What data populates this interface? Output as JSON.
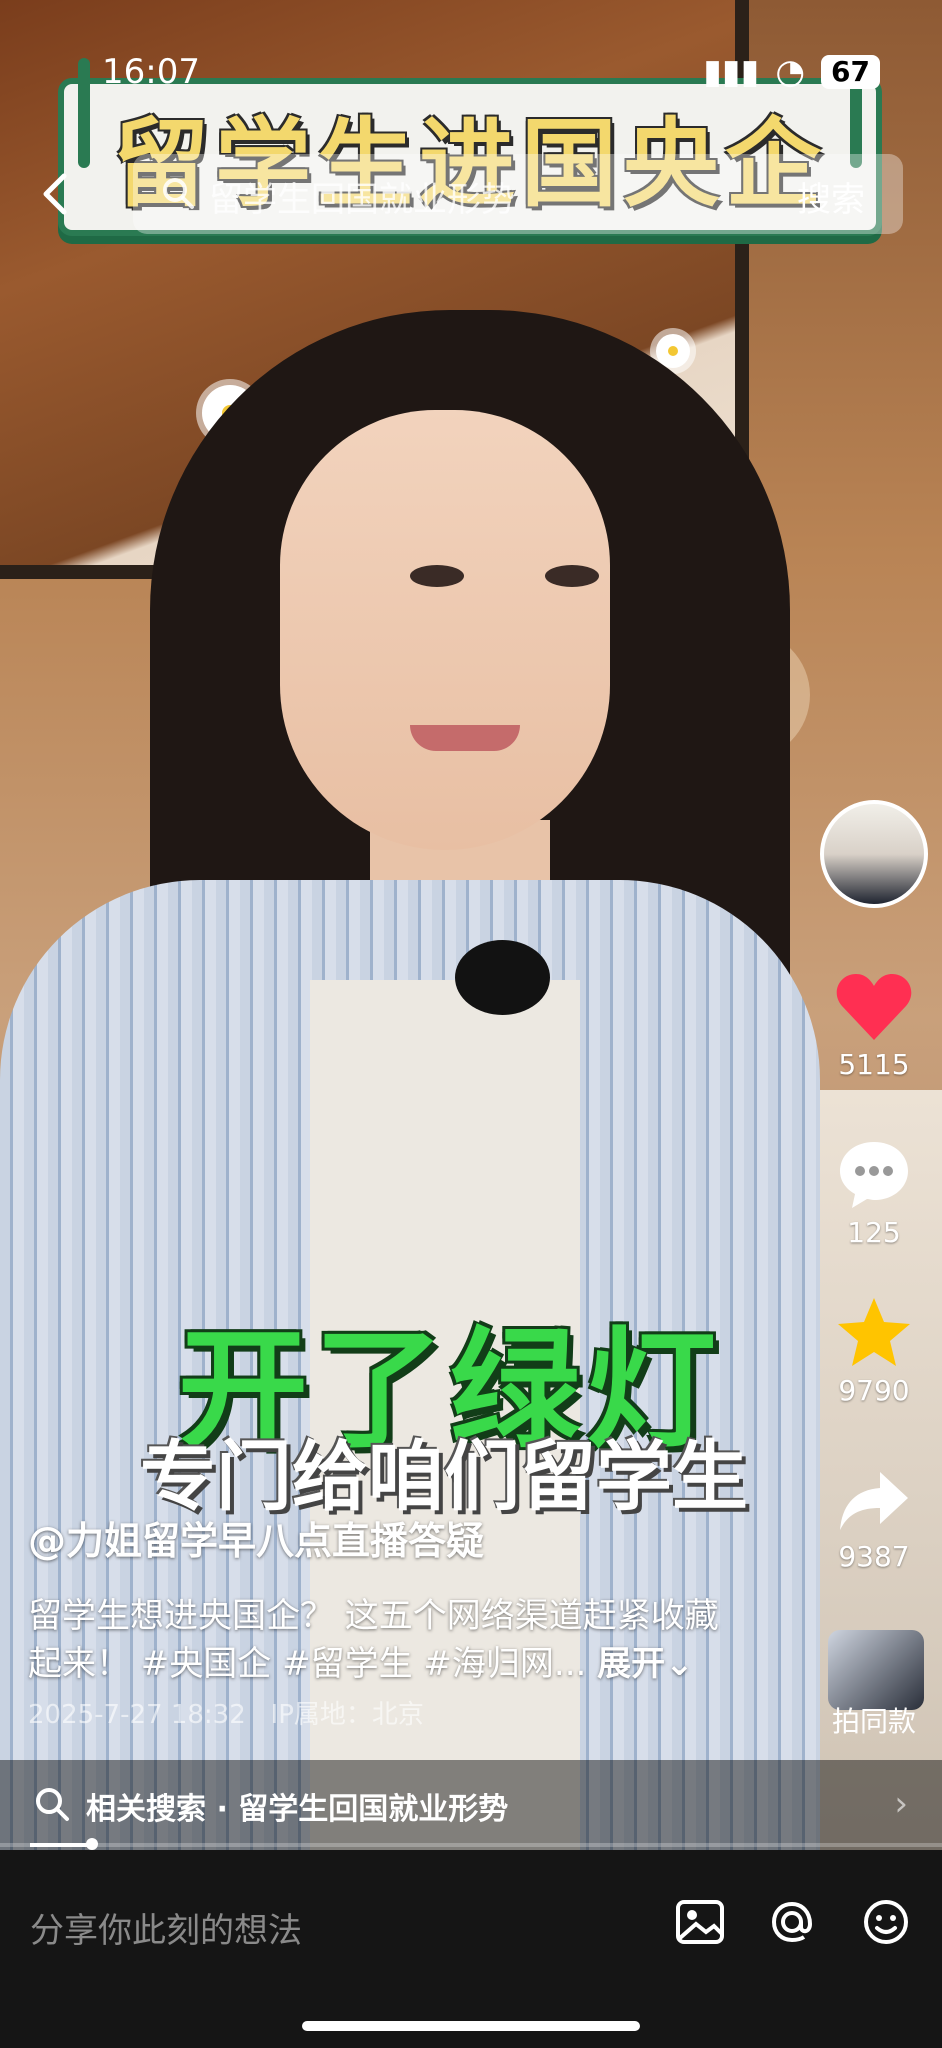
{
  "status_bar": {
    "time": "16:07",
    "battery": "67"
  },
  "header": {
    "banner_title": "留学生进国央企",
    "search_placeholder": "留学生回国就业形势",
    "search_button": "搜索"
  },
  "video": {
    "caption_main": "开了绿灯",
    "caption_sub": "专门给咱们留学生"
  },
  "sidebar": {
    "likes": "5115",
    "comments": "125",
    "favorites": "9790",
    "shares": "9387",
    "template_label": "拍同款"
  },
  "post": {
    "author": "@力姐留学早八点直播答疑",
    "description": "留学生想进央国企？ 这五个网络渠道赶紧收藏起来！ #央国企 #留学生 #海归网...",
    "expand_label": "展开",
    "date": "2025-7-27 18:32",
    "ip_location": "IP属地：北京"
  },
  "related_search": {
    "label": "相关搜索 · 留学生回国就业形势"
  },
  "playback": {
    "progress": 0.07
  },
  "comment_bar": {
    "placeholder": "分享你此刻的想法"
  },
  "colors": {
    "like": "#ff2f52",
    "favorite": "#ffc400",
    "caption_green": "#39d94a",
    "banner_border": "#2a7a52"
  },
  "icons": [
    "back-icon",
    "search-icon",
    "heart-icon",
    "comment-icon",
    "star-icon",
    "share-icon",
    "image-icon",
    "at-icon",
    "emoji-icon"
  ]
}
